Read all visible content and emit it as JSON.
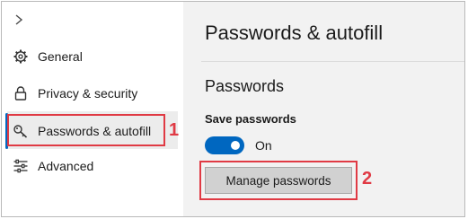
{
  "sidebar": {
    "expand_glyph": ">",
    "items": [
      {
        "label": "General",
        "icon": "gear-icon"
      },
      {
        "label": "Privacy & security",
        "icon": "lock-icon"
      },
      {
        "label": "Passwords & autofill",
        "icon": "key-icon",
        "selected": true
      },
      {
        "label": "Advanced",
        "icon": "sliders-icon"
      }
    ]
  },
  "main": {
    "title": "Passwords & autofill",
    "section": "Passwords",
    "save_passwords": {
      "label": "Save passwords",
      "state": "On",
      "enabled": true
    },
    "manage_button": "Manage passwords"
  },
  "annotations": [
    {
      "label": "1",
      "target": "Passwords & autofill"
    },
    {
      "label": "2",
      "target": "Manage passwords"
    }
  ],
  "colors": {
    "accent": "#0067c0",
    "highlight": "#e03a44",
    "main_bg": "#f2f2f2",
    "button_bg": "#d1d1d1"
  }
}
